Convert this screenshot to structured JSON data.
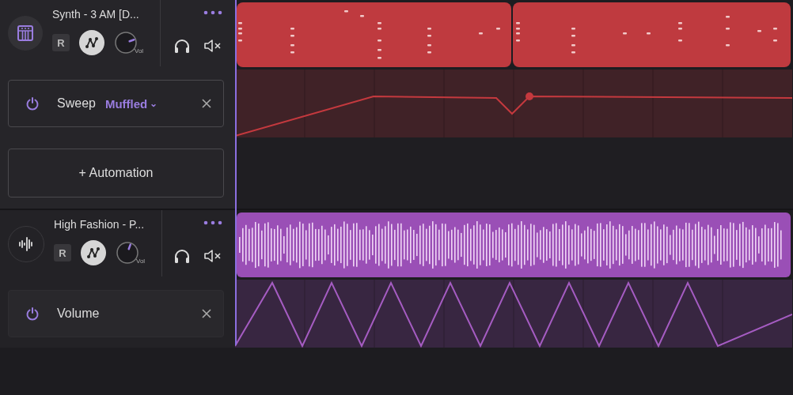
{
  "tracks": [
    {
      "kind": "midi",
      "name": "Synth - 3 AM [D...",
      "record": "R",
      "volume": {
        "label": "Vol"
      },
      "color": "#bf3a3f",
      "automation": [
        {
          "kind": "ramp",
          "name": "Sweep",
          "preset": "Muffled",
          "preset_caret": "⌄",
          "on": true
        }
      ],
      "add_button": "+ Automation"
    },
    {
      "kind": "audio",
      "name": "High Fashion - P...",
      "record": "R",
      "volume": {
        "label": "Vol"
      },
      "color": "#9a4fb6",
      "automation": [
        {
          "kind": "triangle",
          "name": "Volume",
          "on": true
        }
      ]
    }
  ]
}
